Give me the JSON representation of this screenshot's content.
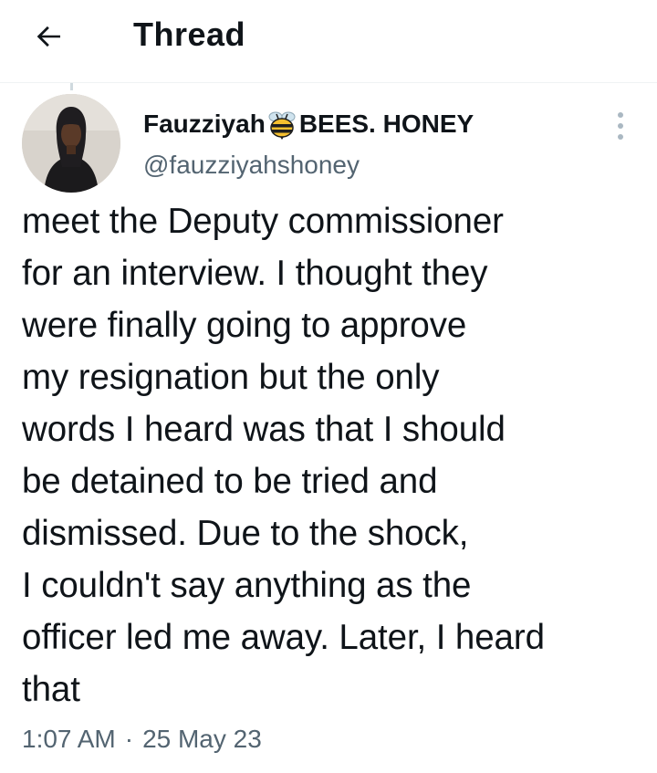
{
  "header": {
    "title": "Thread",
    "back_icon": "arrow-left-icon"
  },
  "tweet": {
    "author": {
      "display_name": "Fauzziyah",
      "emoji_icon": "bee-icon",
      "name_suffix": "BEES. HONEY",
      "handle": "@fauzziyahshoney",
      "avatar_icon": "profile-photo"
    },
    "more_icon": "more-vertical-icon",
    "text": "meet the Deputy commissioner\nfor an interview. I thought they\nwere finally going to approve\nmy resignation but the only\nwords I heard was that I should\nbe detained to be tried and\ndismissed. Due to the shock,\nI couldn't say anything as the\nofficer led me away. Later, I heard\nthat",
    "time": "1:07 AM",
    "separator": "·",
    "date": "25 May 23"
  },
  "colors": {
    "text_primary": "#0f1419",
    "text_secondary": "#536471",
    "divider": "#eff3f4",
    "thread_line": "#cfd9de"
  }
}
